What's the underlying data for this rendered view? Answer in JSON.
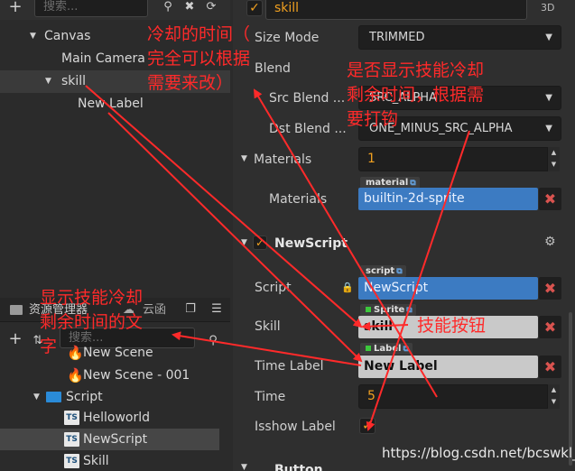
{
  "hierarchy": {
    "search_placeholder": "搜索...",
    "tree": [
      {
        "label": "Canvas"
      },
      {
        "label": "Main Camera"
      },
      {
        "label": "skill"
      },
      {
        "label": "New Label"
      }
    ]
  },
  "assets": {
    "tabs": [
      "资源管理器",
      "云函"
    ],
    "search_placeholder": "搜索...",
    "items": [
      {
        "label": "New Scene",
        "icon": "scene-icon"
      },
      {
        "label": "New Scene - 001",
        "icon": "scene-icon"
      },
      {
        "label": "Script",
        "icon": "folder-icon"
      },
      {
        "label": "Helloworld",
        "icon": "ts-icon"
      },
      {
        "label": "NewScript",
        "icon": "ts-icon"
      },
      {
        "label": "Skill",
        "icon": "ts-icon"
      }
    ],
    "ts_badge": "TS"
  },
  "inspector": {
    "node_name": "skill",
    "mode_3d": "3D",
    "sprite": {
      "size_mode_label": "Size Mode",
      "size_mode_value": "TRIMMED",
      "blend_label": "Blend",
      "src_blend_label": "Src Blend ...",
      "src_blend_value": "SRC_ALPHA",
      "dst_blend_label": "Dst Blend ...",
      "dst_blend_value": "ONE_MINUS_SRC_ALPHA",
      "materials_label": "Materials",
      "materials_count": "1",
      "materials_item_label": "Materials",
      "material_tag": "material",
      "material_value": "builtin-2d-sprite"
    },
    "newscript": {
      "title": "NewScript",
      "script_label": "Script",
      "script_tag": "script",
      "script_value": "NewScript",
      "skill_label": "Skill",
      "skill_tag": "Sprite",
      "skill_value": "skill",
      "time_label_label": "Time Label",
      "time_label_tag": "Label",
      "time_label_value": "New Label",
      "time_label": "Time",
      "time_value": "5",
      "isshow_label": "Isshow Label"
    },
    "button_section": "Button"
  },
  "annotations": {
    "cooldown": "冷却的时间（\n完全可以根据\n需要来改）",
    "show_remaining": "是否显示技能冷却\n剩余时间，根据需\n要打钩",
    "skill_button": "技能按钮",
    "remaining_text": "显示技能冷却\n剩余时间的文\n字"
  },
  "watermark": "https://blog.csdn.net/bcswkl_",
  "colors": {
    "annotation": "#ff2a2a",
    "checkbox_tick": "#f0a020",
    "object_blue": "#3c7bc2"
  }
}
